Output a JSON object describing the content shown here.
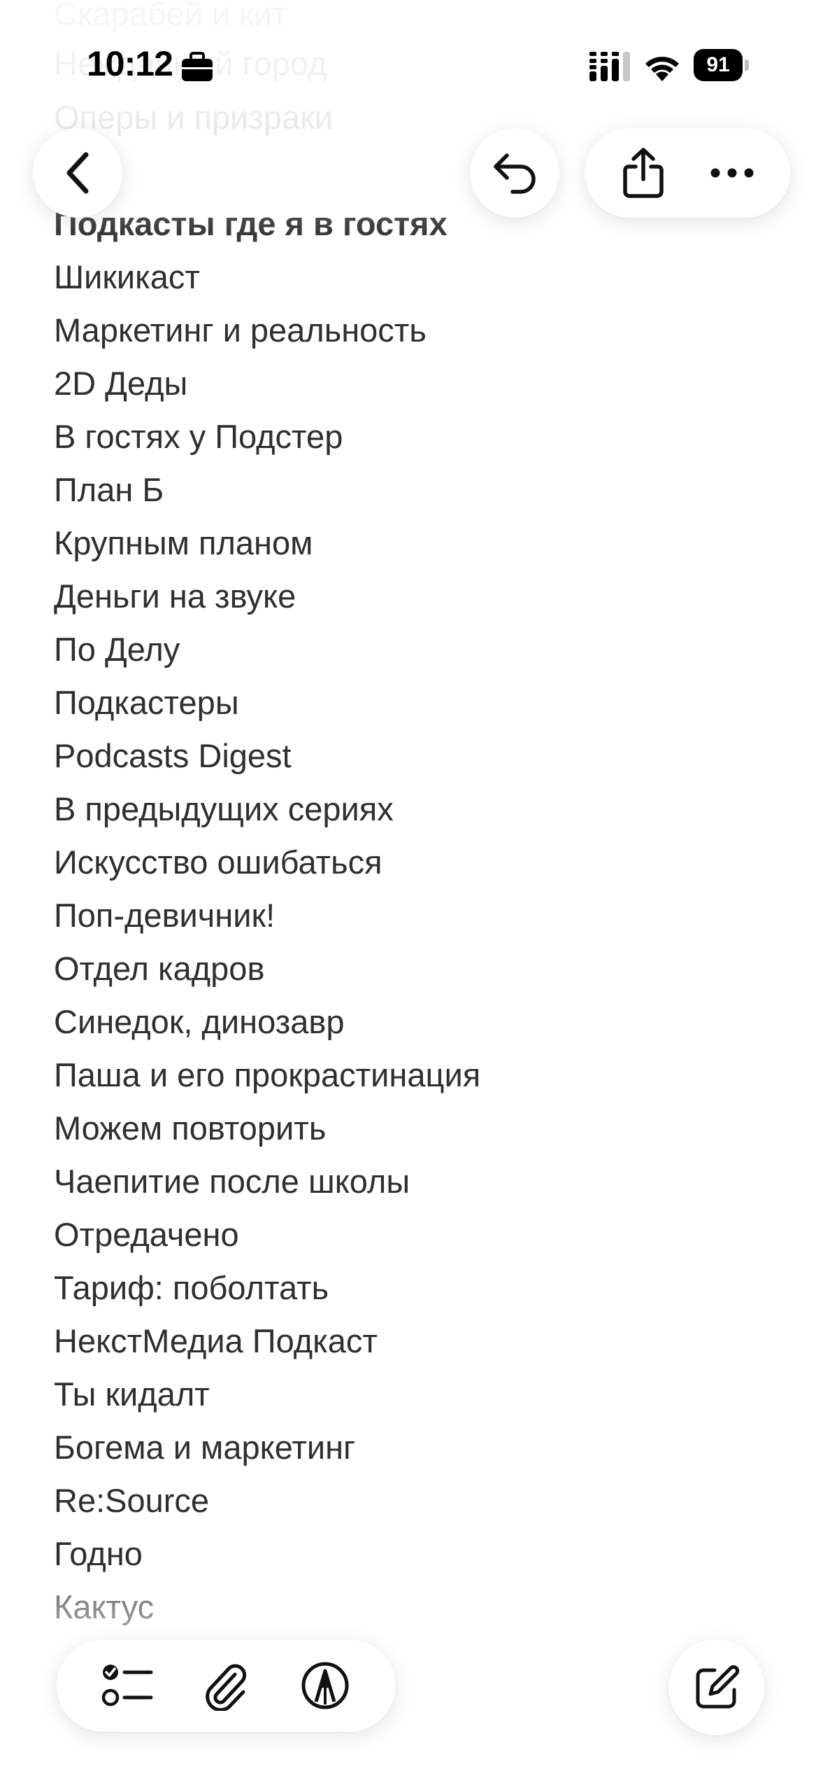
{
  "status_bar": {
    "time": "10:12",
    "battery": "91",
    "icons": [
      "briefcase-icon",
      "cellular-signal-icon",
      "wifi-icon",
      "battery-icon"
    ]
  },
  "toolbar": {
    "back_icon": "chevron-left-icon",
    "undo_icon": "undo-icon",
    "share_icon": "share-icon",
    "more_icon": "ellipsis-icon"
  },
  "note": {
    "faded_lines": [
      "Скарабей и кит",
      "Нежданный город",
      "Оперы и призраки"
    ],
    "heading": "Подкасты где я в гостях",
    "items": [
      "Шикикаст",
      "Маркетинг и реальность",
      "2D Деды",
      "В гостях у Подстер",
      "План Б",
      "Крупным планом",
      "Деньги на звуке",
      "По Делу",
      "Подкастеры",
      "Podcasts Digest",
      "В предыдущих сериях",
      "Искусство ошибаться",
      "Поп-девичник!",
      "Отдел кадров",
      "Синедок, динозавр",
      "Паша и его прокрастинация",
      "Можем повторить",
      "Чаепитие после школы",
      "Отредачено",
      "Тариф: поболтать",
      "НекстМедиа Подкаст",
      "Ты кидалт",
      "Богема и маркетинг",
      "Re:Source",
      "Годно",
      "Кактус"
    ]
  },
  "bottom_toolbar": {
    "checklist_icon": "checklist-icon",
    "attach_icon": "paperclip-icon",
    "markup_icon": "pen-markup-icon",
    "compose_icon": "compose-icon"
  },
  "colors": {
    "text": "#2f2f31",
    "faded_text": "#c9c9cc",
    "background": "#ffffff"
  }
}
